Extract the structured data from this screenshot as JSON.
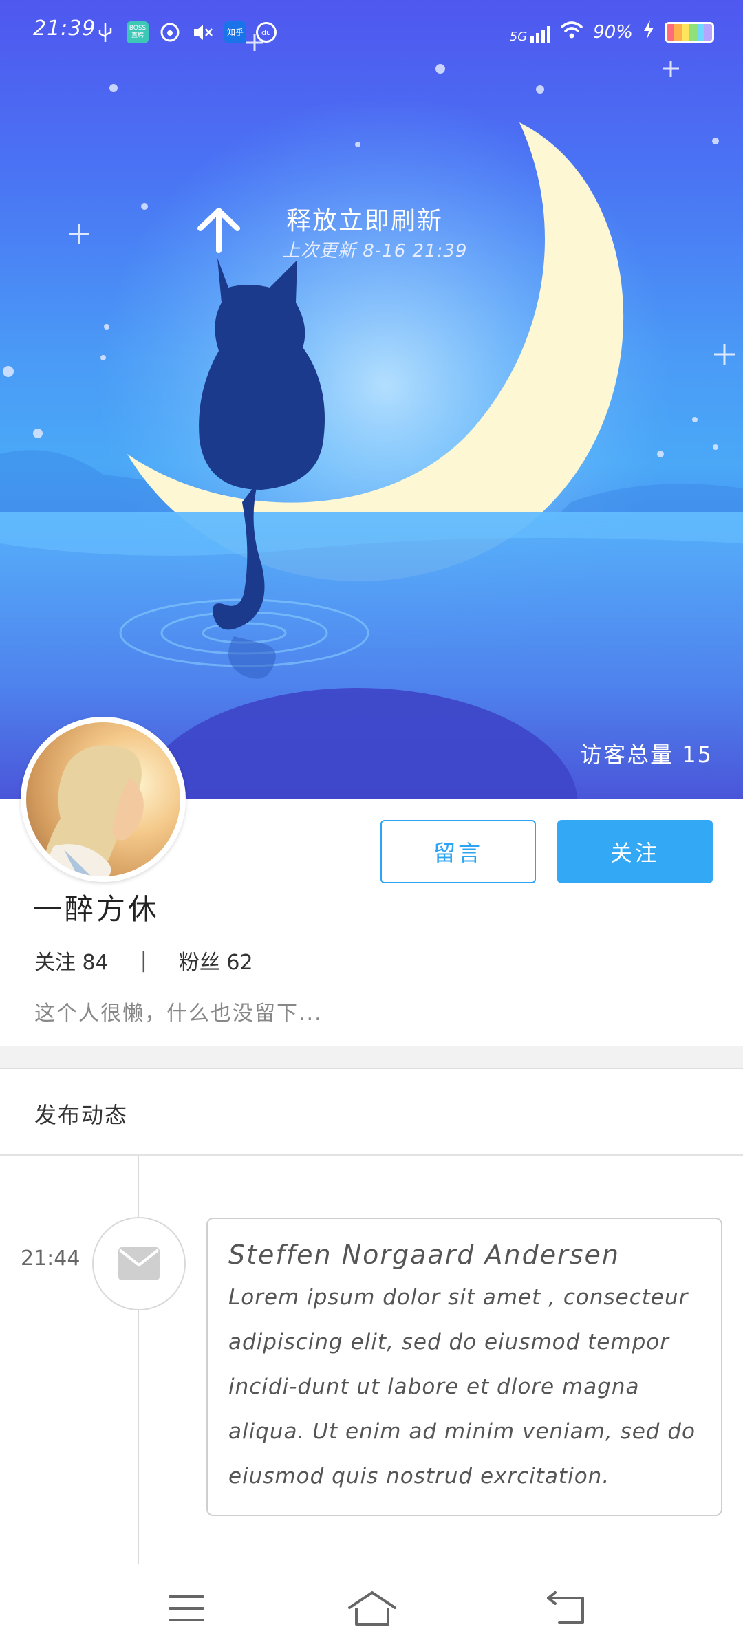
{
  "status_bar": {
    "time": "21:39",
    "network": "5G",
    "battery": "90%",
    "app_icon_boss": "BOSS 直聘",
    "app_icon_zhihu": "知乎",
    "app_icon_du": "du",
    "icons": [
      "usb-icon",
      "boss-app-icon",
      "netease-music-icon",
      "mute-icon",
      "zhihu-app-icon",
      "map-pin-icon",
      "signal-icon",
      "wifi-icon",
      "charging-icon",
      "battery-icon"
    ]
  },
  "refresh": {
    "title": "释放立即刷新",
    "subtitle": "上次更新 8-16 21:39"
  },
  "hero": {
    "visitors": "访客总量 15"
  },
  "profile": {
    "username": "一醉方休",
    "following_label": "关注 84",
    "separator": "|",
    "followers_label": "粉丝 62",
    "bio": "这个人很懒，什么也没留下..."
  },
  "actions": {
    "message_label": "留言",
    "follow_label": "关注"
  },
  "section": {
    "post_title": "发布动态"
  },
  "timeline": {
    "items": [
      {
        "time": "21:44",
        "icon": "mail-icon",
        "title": "Steffen Norgaard Andersen",
        "body": "Lorem ipsum dolor sit amet , consecteur adipiscing elit, sed do eiusmod tempor incidi-dunt ut labore et dlore magna aliqua. Ut enim ad minim veniam, sed do eiusmod quis nostrud exrcitation."
      }
    ]
  },
  "nav": {
    "icons": [
      "menu-icon",
      "home-icon",
      "back-icon"
    ]
  },
  "colors": {
    "accent": "#33a9f5",
    "hero_top": "#4f57ef",
    "hero_mid": "#4aa8f7",
    "moon": "#fdf7d4",
    "cat": "#1b3a8c"
  }
}
